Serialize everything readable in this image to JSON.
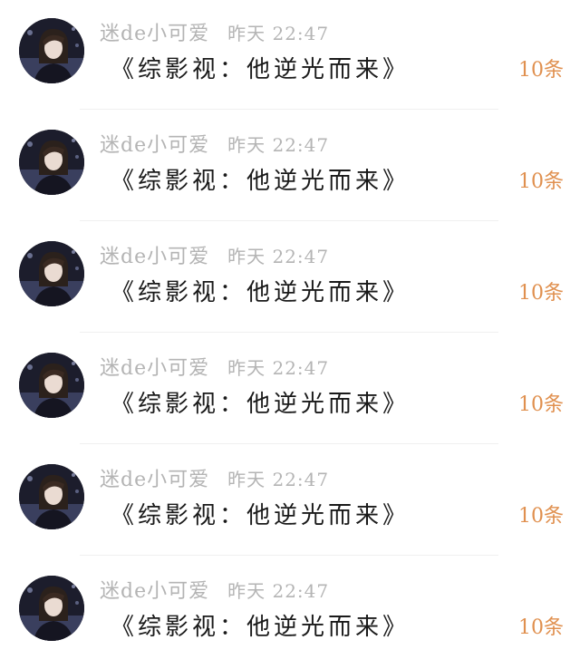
{
  "items": [
    {
      "author": "迷de小可爱",
      "time": "昨天 22:47",
      "title": "《综影视：他逆光而来》",
      "count": "10条",
      "avatar_icon": "user-avatar"
    },
    {
      "author": "迷de小可爱",
      "time": "昨天 22:47",
      "title": "《综影视：他逆光而来》",
      "count": "10条",
      "avatar_icon": "user-avatar"
    },
    {
      "author": "迷de小可爱",
      "time": "昨天 22:47",
      "title": "《综影视：他逆光而来》",
      "count": "10条",
      "avatar_icon": "user-avatar"
    },
    {
      "author": "迷de小可爱",
      "time": "昨天 22:47",
      "title": "《综影视：他逆光而来》",
      "count": "10条",
      "avatar_icon": "user-avatar"
    },
    {
      "author": "迷de小可爱",
      "time": "昨天 22:47",
      "title": "《综影视：他逆光而来》",
      "count": "10条",
      "avatar_icon": "user-avatar"
    },
    {
      "author": "迷de小可爱",
      "time": "昨天 22:47",
      "title": "《综影视：他逆光而来》",
      "count": "10条",
      "avatar_icon": "user-avatar"
    }
  ],
  "colors": {
    "meta_text": "#b4b4b4",
    "title_text": "#1a1a1a",
    "count_accent": "#e0904f",
    "divider": "#f0f0f0"
  }
}
